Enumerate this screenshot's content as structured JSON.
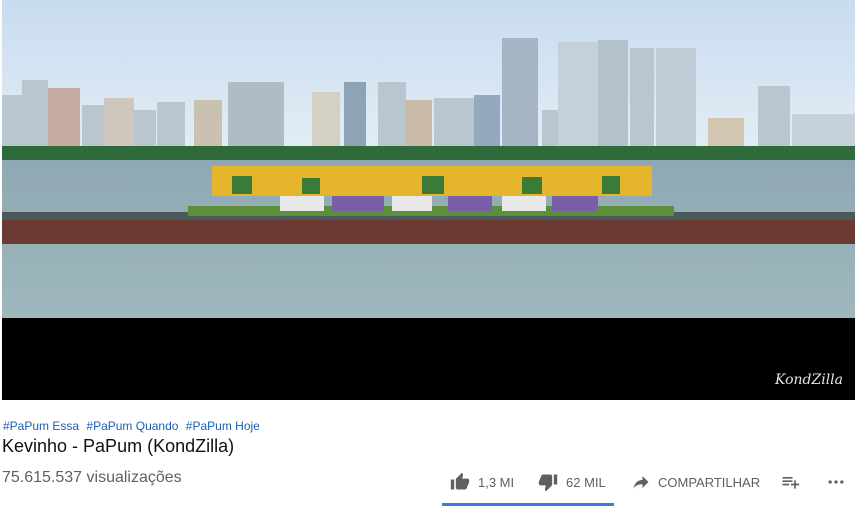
{
  "video": {
    "watermark": "KondZilla"
  },
  "hashtags": [
    "#PaPum Essa",
    "#PaPum Quando",
    "#PaPum Hoje"
  ],
  "title": "Kevinho - PaPum (KondZilla)",
  "views": "75.615.537 visualizações",
  "actions": {
    "like": {
      "count": "1,3 MI",
      "icon": "thumbs-up-icon"
    },
    "dislike": {
      "count": "62 MIL",
      "icon": "thumbs-down-icon"
    },
    "share": {
      "label": "COMPARTILHAR",
      "icon": "share-arrow-icon"
    },
    "save": {
      "icon": "add-to-playlist-icon"
    },
    "more": {
      "icon": "more-horizontal-icon"
    }
  },
  "sentiment": {
    "like_fraction": 1.0
  },
  "colors": {
    "link": "#1a5fb4",
    "meta": "#606060",
    "title": "#111111"
  }
}
